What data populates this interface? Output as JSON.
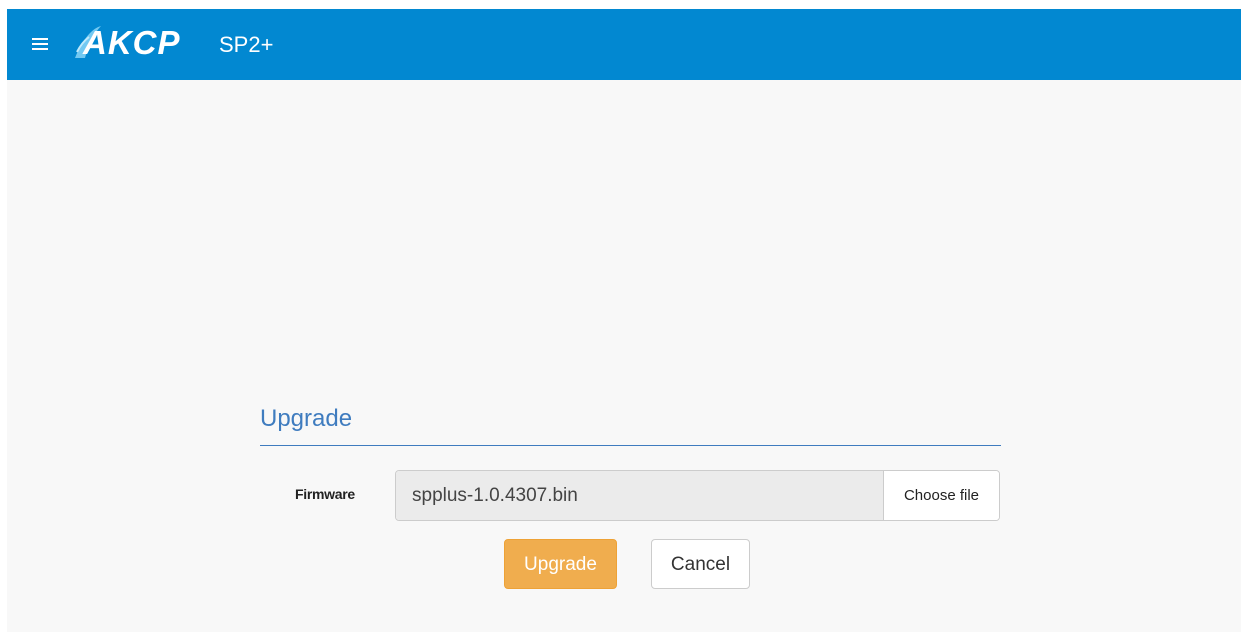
{
  "header": {
    "menu_icon": "hamburger-menu-icon",
    "brand": "AKCP",
    "product": "SP2+",
    "background_color": "#0288d1"
  },
  "upgrade_form": {
    "title": "Upgrade",
    "title_color": "#3f7cbf",
    "firmware_label": "Firmware",
    "file_value": "spplus-1.0.4307.bin",
    "choose_file_label": "Choose file",
    "upgrade_button": "Upgrade",
    "upgrade_button_color": "#f0ad4e",
    "cancel_button": "Cancel"
  }
}
